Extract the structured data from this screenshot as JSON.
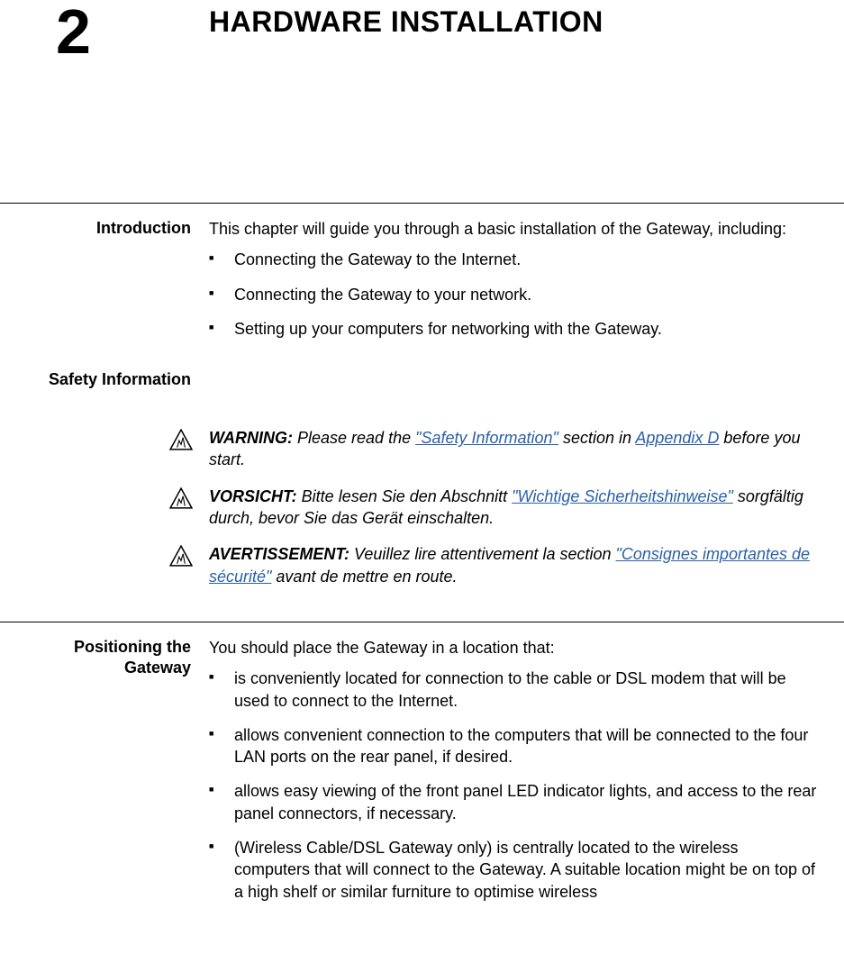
{
  "chapter": {
    "number": "2",
    "title": "HARDWARE INSTALLATION"
  },
  "intro": {
    "heading": "Introduction",
    "lead": "This chapter will guide you through a basic installation of the Gateway, including:",
    "bullets": [
      "Connecting the Gateway to the Internet.",
      "Connecting the Gateway to your network.",
      "Setting up your computers for networking with the Gateway."
    ]
  },
  "safety": {
    "heading": "Safety Information",
    "warnings": [
      {
        "lead": "WARNING:",
        "pre": " Please read the ",
        "link": "\"Safety Information\"",
        "mid": " section in ",
        "link2": "Appendix D",
        "post": " before you start."
      },
      {
        "lead": "VORSICHT:",
        "pre": " Bitte lesen Sie den Abschnitt ",
        "link": "\"Wichtige Sicherheitshinweise\"",
        "mid": "",
        "link2": "",
        "post": " sorgfältig durch, bevor Sie das Gerät einschalten."
      },
      {
        "lead": "AVERTISSEMENT:",
        "pre": " Veuillez lire attentivement la section ",
        "link": "\"Consignes importantes de sécurité\"",
        "mid": "",
        "link2": "",
        "post": " avant de mettre en route."
      }
    ]
  },
  "positioning": {
    "heading": "Positioning the Gateway",
    "lead": "You should place the Gateway in a location that:",
    "bullets": [
      "is conveniently located for connection to the cable or DSL modem that will be used to connect to the Internet.",
      "allows convenient connection to the computers that will be connected to the four LAN ports on the rear panel, if desired.",
      "allows easy viewing of the front panel LED indicator lights, and access to the rear panel connectors, if necessary.",
      "(Wireless Cable/DSL Gateway only) is centrally located to the wireless computers that will connect to the Gateway. A suitable location might be on top of a high shelf or similar furniture to optimise wireless"
    ]
  }
}
